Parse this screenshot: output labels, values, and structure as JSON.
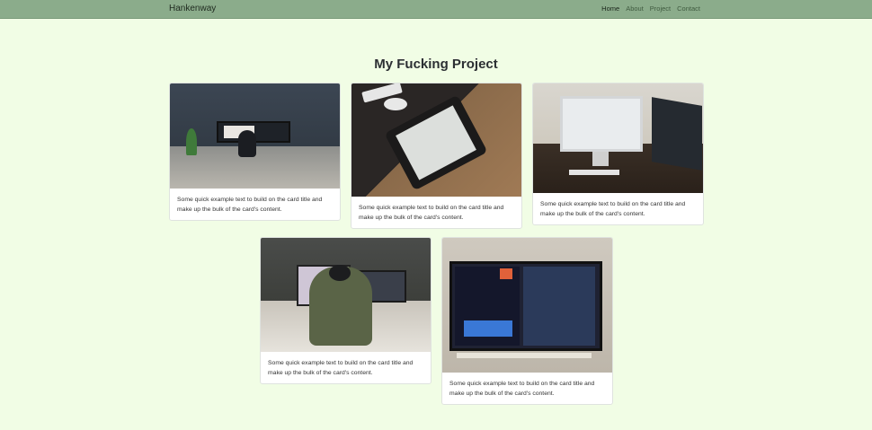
{
  "navbar": {
    "brand": "Hankenway",
    "links": [
      "Home",
      "About",
      "Project",
      "Contact"
    ]
  },
  "page": {
    "title": "My Fucking Project"
  },
  "cards": [
    {
      "text": "Some quick example text to build on the card title and make up the bulk of the card's content.",
      "image": "person-at-desk-with-monitor"
    },
    {
      "text": "Some quick example text to build on the card title and make up the bulk of the card's content.",
      "image": "tablet-sketching-on-desk"
    },
    {
      "text": "Some quick example text to build on the card title and make up the bulk of the card's content.",
      "image": "imac-workspace-by-window"
    },
    {
      "text": "Some quick example text to build on the card title and make up the bulk of the card's content.",
      "image": "person-at-dual-monitors"
    },
    {
      "text": "Some quick example text to build on the card title and make up the bulk of the card's content.",
      "image": "dual-monitor-design-setup"
    }
  ]
}
